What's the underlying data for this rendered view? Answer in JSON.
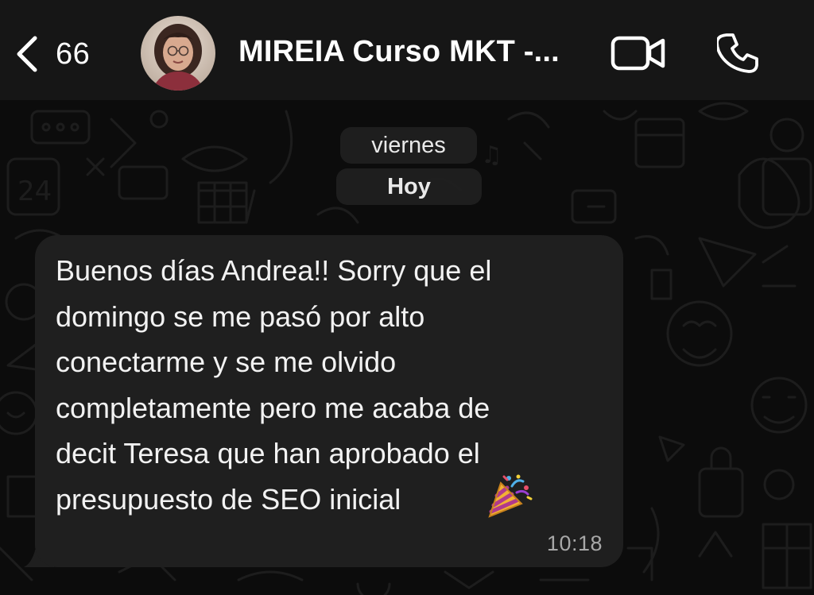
{
  "header": {
    "back_count": "66",
    "chat_title": "MIREIA Curso MKT -...",
    "icons": {
      "back": "chevron-left-icon",
      "video": "video-camera-icon",
      "call": "phone-icon"
    }
  },
  "date_chips": {
    "previous": "viernes",
    "today": "Hoy"
  },
  "message": {
    "text": "Buenos días Andrea!! Sorry que el\ndomingo se me pasó por alto\nconectarme y se me olvido\ncompletamente pero me acaba de\ndecit Teresa que han aprobado el\npresupuesto de SEO inicial",
    "emoji": "party-popper-icon",
    "time": "10:18"
  },
  "colors": {
    "header_bg": "#161616",
    "chat_bg": "#0c0c0c",
    "bubble_bg": "#1f1f1f",
    "text": "#ffffff",
    "time_text": "#a8a8a8"
  }
}
